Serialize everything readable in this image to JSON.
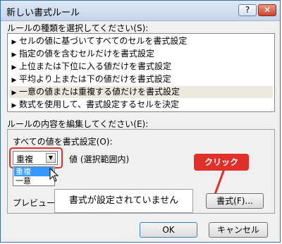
{
  "window": {
    "title": "新しい書式ルール",
    "help": "?",
    "close": "✕"
  },
  "rule_type": {
    "label": "ルールの種類を選択してください(S):",
    "items": [
      "セルの値に基づいてすべてのセルを書式設定",
      "指定の値を含むセルだけを書式設定",
      "上位または下位に入る値だけを書式設定",
      "平均より上または下の値だけを書式設定",
      "一意の値または重複する値だけを書式設定",
      "数式を使用して、書式設定するセルを決定"
    ],
    "selected_index": 4
  },
  "rule_edit": {
    "label": "ルールの内容を編集してください(E):",
    "format_all_label": "すべての値を書式設定(O):",
    "combo_value": "重複",
    "combo_suffix": "値 (選択範囲内)",
    "options": [
      "重複",
      "一意"
    ]
  },
  "callout": "クリック",
  "preview": {
    "label": "プレビュー:",
    "text": "書式が設定されていません",
    "format_button": "書式(F)..."
  },
  "footer": {
    "ok": "OK",
    "cancel": "キャンセル"
  }
}
